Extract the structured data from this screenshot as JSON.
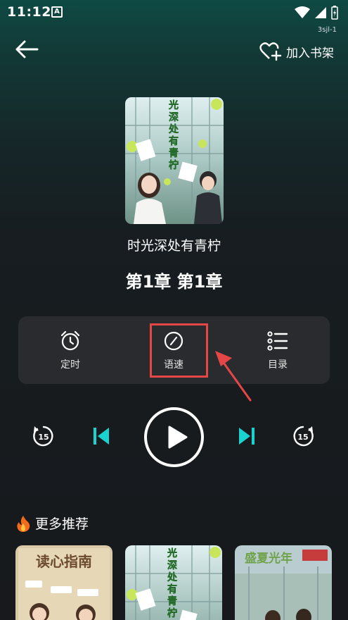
{
  "status_bar": {
    "time": "11:12",
    "notification_glyph": "A",
    "carrier": "3sjl-1"
  },
  "header": {
    "add_to_shelf_label": "加入书架"
  },
  "book": {
    "cover_title": "光深处有青柠",
    "title": "时光深处有青柠",
    "chapter": "第1章  第1章"
  },
  "controls": {
    "timer_label": "定时",
    "speed_label": "语速",
    "toc_label": "目录"
  },
  "player": {
    "skip_amount": "15"
  },
  "recommend": {
    "title": "更多推荐",
    "thumb1_title": "读心指南",
    "thumb2_title": "光深处有青柠",
    "thumb3_title": "盛夏光年"
  },
  "colors": {
    "accent_cyan": "#19d3d0",
    "annotation_red": "#e54646",
    "panel_bg": "#2a2b2e"
  }
}
